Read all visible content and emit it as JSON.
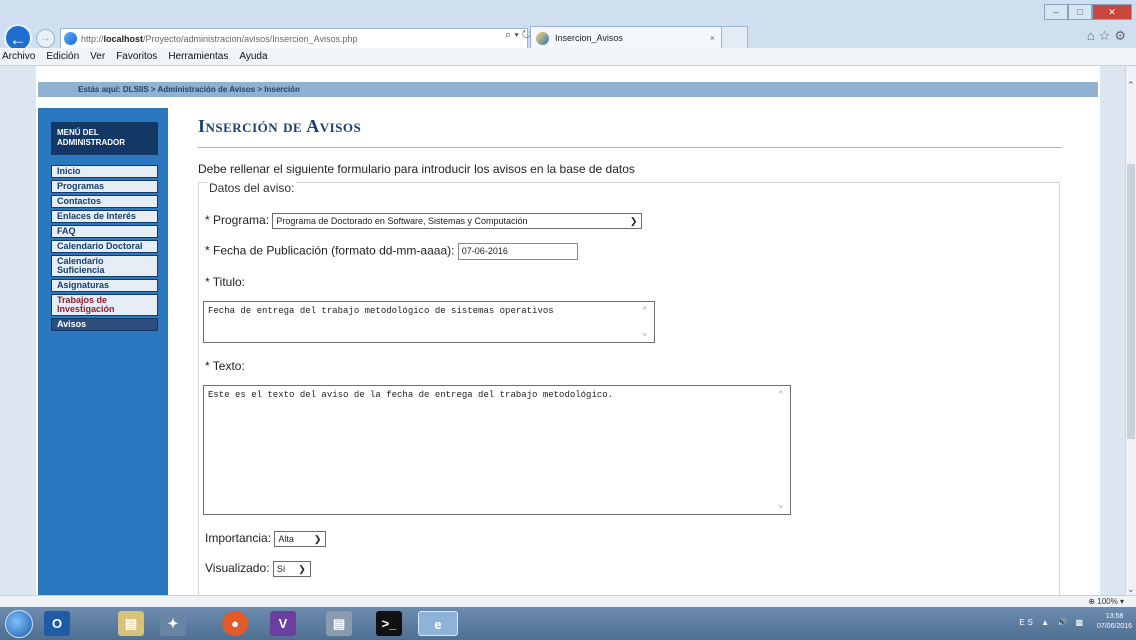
{
  "browser": {
    "url_prefix": "http://",
    "url_host": "localhost",
    "url_path": "/Proyecto/administracion/avisos/Insercion_Avisos.php",
    "address_controls": "⌕ ▾ ↻",
    "tab_title": "Insercion_Avisos",
    "tab_close": "×",
    "zoom": "100%"
  },
  "menubar": [
    "Archivo",
    "Edición",
    "Ver",
    "Favoritos",
    "Herramientas",
    "Ayuda"
  ],
  "breadcrumb": "Estás aquí: DLSIIS > Administración de Avisos > Inserción",
  "sidebar": {
    "title_line1": "Menú del",
    "title_line2": "Administrador",
    "items": [
      "Inicio",
      "Programas",
      "Contactos",
      "Enlaces de Interés",
      "FAQ",
      "Calendario Doctoral",
      "Calendario Suficiencia",
      "Asignaturas",
      "Trabajos de Investigación",
      "Avisos"
    ]
  },
  "main": {
    "heading": "Inserción de Avisos",
    "intro": "Debe rellenar el siguiente formulario para introducir los avisos en la base de datos",
    "legend": "Datos del aviso:",
    "programa_label": "* Programa:",
    "programa_value": "Programa de Doctorado en Software, Sistemas y Computación",
    "fecha_label": "* Fecha de Publicación (formato dd-mm-aaaa):",
    "fecha_value": "07-06-2016",
    "titulo_label": "* Titulo:",
    "titulo_value": "Fecha de entrega del trabajo metodológico de sistemas operativos",
    "texto_label": "* Texto:",
    "texto_value": "Este es el texto del aviso de la fecha de entrega del trabajo metodológico.",
    "importancia_label": "Importancia:",
    "importancia_value": "Alta",
    "visualizado_label": "Visualizado:",
    "visualizado_value": "Sí"
  },
  "taskbar": {
    "tray_lang": "ES",
    "time": "13:58",
    "date": "07/06/2016"
  }
}
